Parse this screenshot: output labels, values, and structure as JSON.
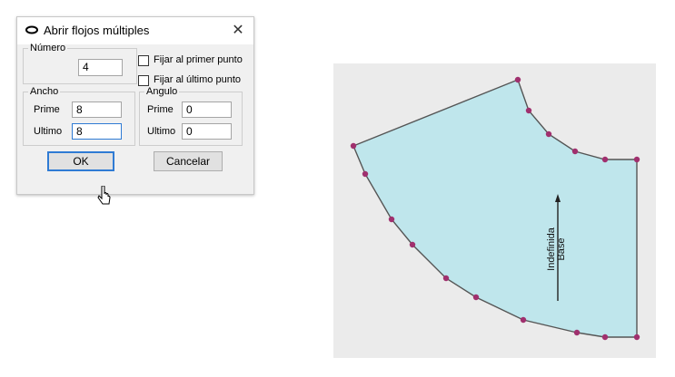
{
  "dialog": {
    "title": "Abrir flojos múltiples",
    "close_glyph": "✕",
    "numero": {
      "legend": "Número",
      "value": "4"
    },
    "checkboxes": [
      {
        "label": "Fijar al primer punto",
        "checked": false
      },
      {
        "label": "Fijar al último punto",
        "checked": false
      }
    ],
    "ancho": {
      "legend": "Ancho",
      "prime_label": "Prime",
      "prime_value": "8",
      "ultimo_label": "Ultimo",
      "ultimo_value": "8"
    },
    "angulo": {
      "legend": "Angulo",
      "prime_label": "Prime",
      "prime_value": "0",
      "ultimo_label": "Ultimo",
      "ultimo_value": "0"
    },
    "ok_label": "OK",
    "cancel_label": "Cancelar"
  },
  "pattern": {
    "label_line1": "Indefinida",
    "label_line2": "Base",
    "fill_color": "#bfe6ec",
    "point_color": "#a0306e",
    "background": "#ebebeb"
  }
}
